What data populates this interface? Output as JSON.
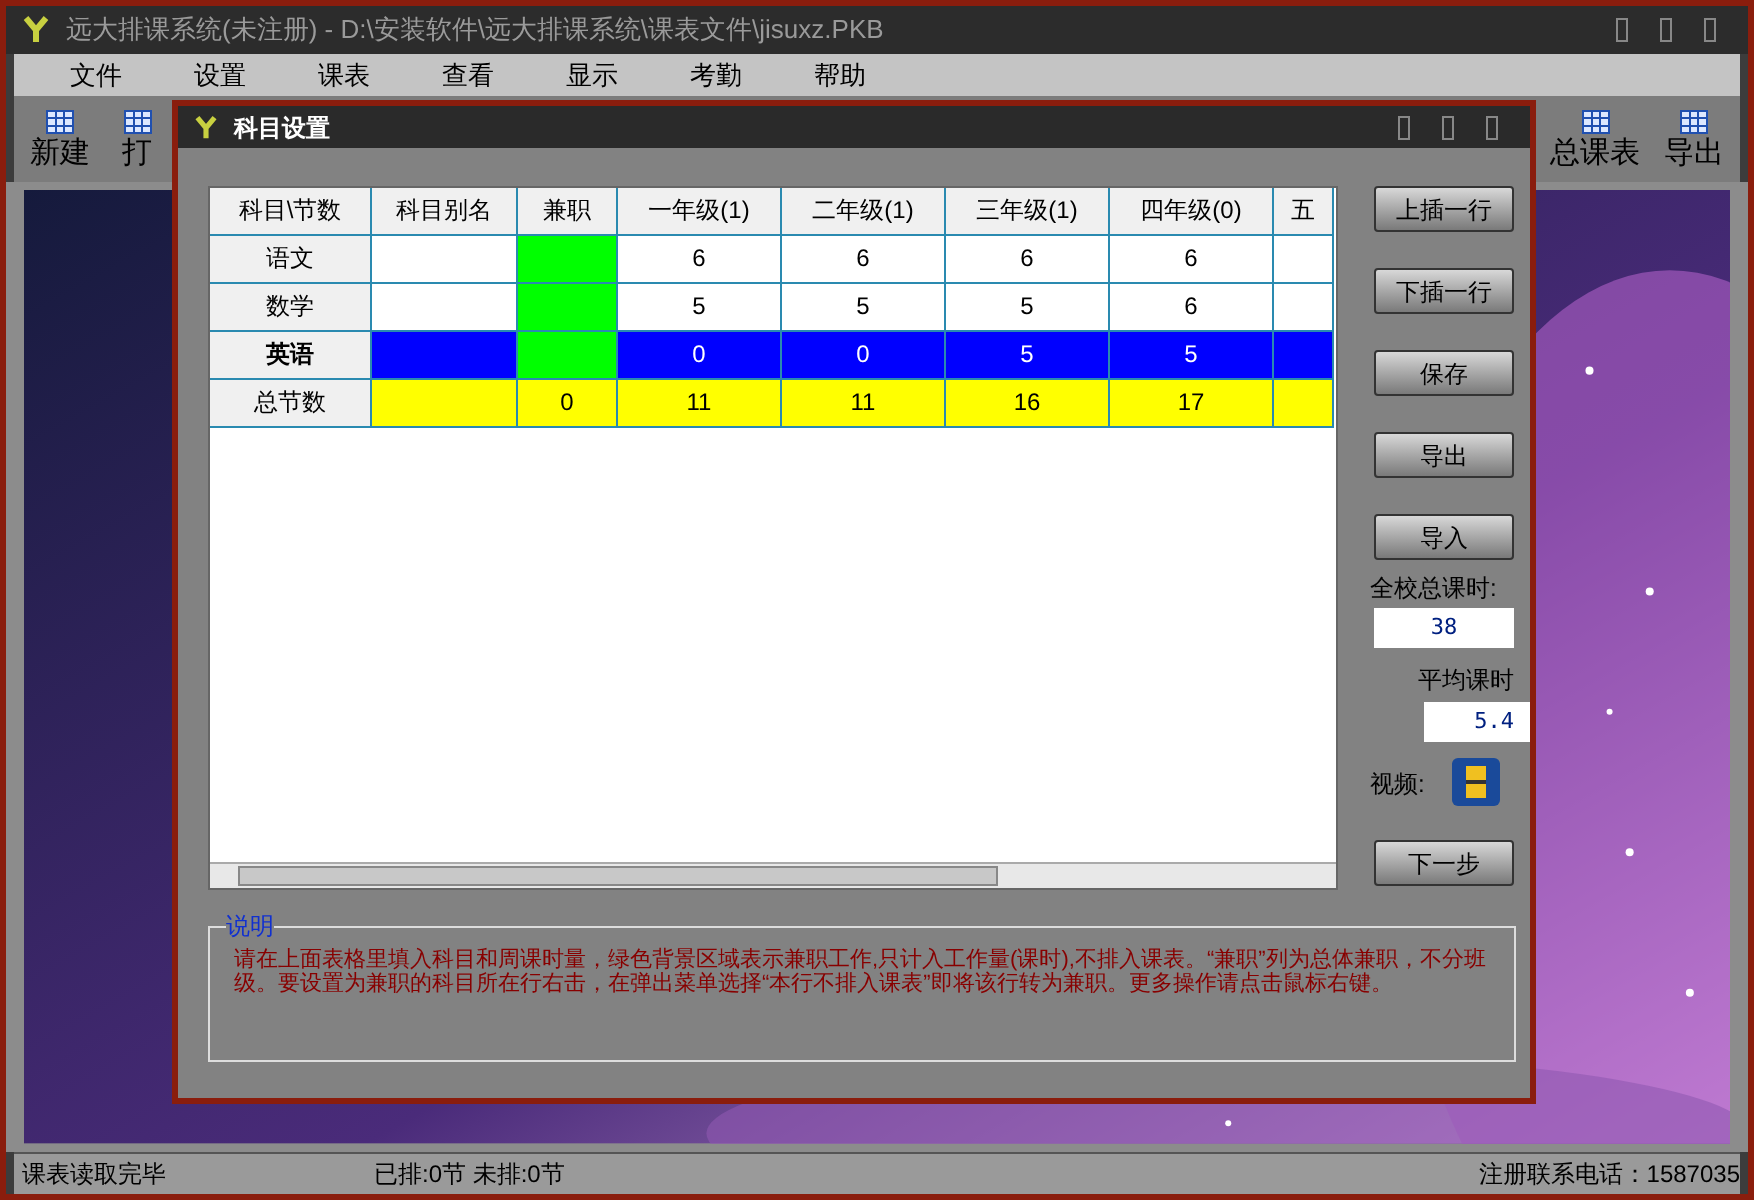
{
  "window": {
    "title": "远大排课系统(未注册) - D:\\安装软件\\远大排课系统\\课表文件\\jisuxz.PKB"
  },
  "menu": [
    "文件",
    "设置",
    "课表",
    "查看",
    "显示",
    "考勤",
    "帮助"
  ],
  "toolbar_left": [
    "新建",
    "打"
  ],
  "toolbar_right": [
    "总课表",
    "导出"
  ],
  "dialog": {
    "title": "科目设置",
    "table": {
      "columns": [
        "科目\\节数",
        "科目别名",
        "兼职",
        "一年级(1)",
        "二年级(1)",
        "三年级(1)",
        "四年级(0)",
        "五"
      ],
      "rows": [
        {
          "kind": "subject",
          "selected": false,
          "part_time": true,
          "cells": [
            "语文",
            "",
            "",
            "6",
            "6",
            "6",
            "6",
            ""
          ]
        },
        {
          "kind": "subject",
          "selected": false,
          "part_time": true,
          "cells": [
            "数学",
            "",
            "",
            "5",
            "5",
            "5",
            "6",
            ""
          ]
        },
        {
          "kind": "subject",
          "selected": true,
          "part_time": true,
          "cells": [
            "英语",
            "",
            "",
            "0",
            "0",
            "5",
            "5",
            ""
          ]
        },
        {
          "kind": "total",
          "cells": [
            "总节数",
            "",
            "0",
            "11",
            "11",
            "16",
            "17",
            ""
          ]
        }
      ]
    },
    "buttons": [
      "上插一行",
      "下插一行",
      "保存",
      "导出",
      "导入"
    ],
    "total_label": "全校总课时:",
    "total_value": "38",
    "avg_label": "平均课时",
    "avg_value": "5.4",
    "video_label": "视频:",
    "next_button": "下一步",
    "note": {
      "title": "说明",
      "text": "请在上面表格里填入科目和周课时量，绿色背景区域表示兼职工作,只计入工作量(课时),不排入课表。“兼职”列为总体兼职，不分班级。要设置为兼职的科目所在行右击，在弹出菜单选择“本行不排入课表”即将该行转为兼职。更多操作请点击鼠标右键。"
    }
  },
  "status_bar": [
    "课表读取完毕",
    "已排:0节 未排:0节",
    "注册联系电话：1587035"
  ]
}
